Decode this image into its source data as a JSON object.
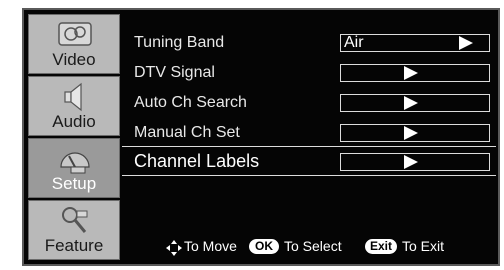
{
  "tabs": [
    {
      "label": "Video",
      "icon": "video-icon",
      "active": false
    },
    {
      "label": "Audio",
      "icon": "speaker-icon",
      "active": false
    },
    {
      "label": "Setup",
      "icon": "setup-icon",
      "active": true
    },
    {
      "label": "Feature",
      "icon": "feature-icon",
      "active": false
    }
  ],
  "menu": {
    "items": [
      {
        "label": "Tuning Band",
        "value": "Air"
      },
      {
        "label": "DTV Signal",
        "value": ""
      },
      {
        "label": "Auto Ch Search",
        "value": ""
      },
      {
        "label": "Manual Ch Set",
        "value": ""
      },
      {
        "label": "Channel Labels",
        "value": "",
        "selected": true
      }
    ]
  },
  "footer": {
    "move_icon": "move-arrows-icon",
    "move_text": "To Move",
    "ok_key": "OK",
    "select_text": "To Select",
    "exit_key": "Exit",
    "exit_text": "To Exit"
  },
  "colors": {
    "background": "#050505",
    "tab": "#b9b9b9",
    "tab_active": "#9a9a9a",
    "text": "#e8e8e8"
  }
}
